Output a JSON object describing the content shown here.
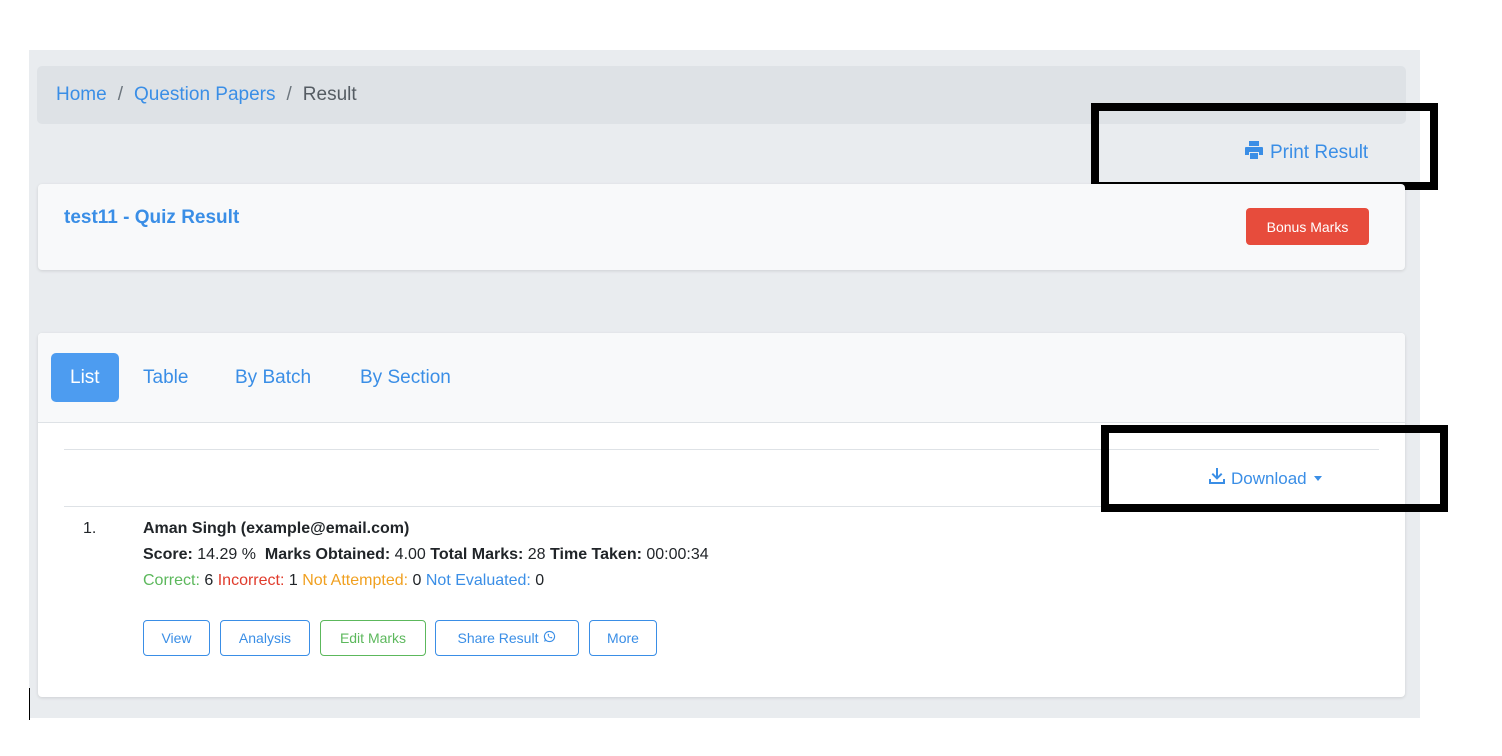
{
  "breadcrumb": {
    "home": "Home",
    "question_papers": "Question Papers",
    "current": "Result",
    "separator": "/"
  },
  "toolbar": {
    "print_label": "Print Result"
  },
  "quiz": {
    "title": "test11 - Quiz Result",
    "bonus_label": "Bonus Marks"
  },
  "tabs": [
    {
      "label": "List",
      "active": true
    },
    {
      "label": "Table",
      "active": false
    },
    {
      "label": "By Batch",
      "active": false
    },
    {
      "label": "By Section",
      "active": false
    }
  ],
  "download": {
    "label": "Download"
  },
  "result": {
    "index": "1.",
    "name": "Aman Singh (example@email.com)",
    "score_label": "Score:",
    "score_value": "14.29 %",
    "marks_obtained_label": "Marks Obtained:",
    "marks_obtained_value": "4.00",
    "total_marks_label": "Total Marks:",
    "total_marks_value": "28",
    "time_taken_label": "Time Taken:",
    "time_taken_value": "00:00:34",
    "correct_label": "Correct:",
    "correct_value": "6",
    "incorrect_label": "Incorrect:",
    "incorrect_value": "1",
    "not_attempted_label": "Not Attempted:",
    "not_attempted_value": "0",
    "not_evaluated_label": "Not Evaluated:",
    "not_evaluated_value": "0",
    "actions": {
      "view": "View",
      "analysis": "Analysis",
      "edit_marks": "Edit Marks",
      "share_result": "Share Result",
      "more": "More"
    }
  },
  "icons": {
    "print": "printer-icon",
    "download": "download-icon",
    "caret": "caret-down-icon",
    "share": "whatsapp-icon"
  },
  "colors": {
    "primary": "#3a8ee6",
    "active_tab": "#4d9cf0",
    "danger": "#e74c3c",
    "success": "#5cb85c",
    "warning": "#f0a020"
  }
}
